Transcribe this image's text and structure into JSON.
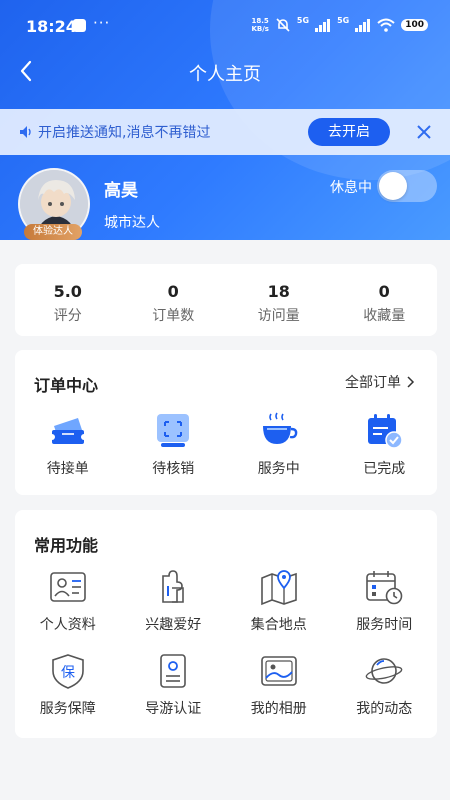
{
  "status_bar": {
    "time": "18:24",
    "dots": "···",
    "speed_value": "18.5",
    "speed_unit": "KB/s",
    "signal_label_1": "5G",
    "signal_label_2": "5G",
    "battery": "100"
  },
  "nav": {
    "title": "个人主页"
  },
  "notify": {
    "text": "开启推送通知,消息不再错过",
    "button": "去开启"
  },
  "profile": {
    "name": "高昊",
    "title": "城市达人",
    "badge": "体验达人",
    "rest_label": "休息中",
    "rest_on": false
  },
  "stats": [
    {
      "value": "5.0",
      "label": "评分"
    },
    {
      "value": "0",
      "label": "订单数"
    },
    {
      "value": "18",
      "label": "访问量"
    },
    {
      "value": "0",
      "label": "收藏量"
    }
  ],
  "orders": {
    "title": "订单中心",
    "all_label": "全部订单",
    "items": [
      {
        "label": "待接单",
        "icon": "ticket-icon"
      },
      {
        "label": "待核销",
        "icon": "scan-icon"
      },
      {
        "label": "服务中",
        "icon": "coffee-cup-icon"
      },
      {
        "label": "已完成",
        "icon": "calendar-check-icon"
      }
    ]
  },
  "functions": {
    "title": "常用功能",
    "items": [
      {
        "label": "个人资料",
        "icon": "id-card-icon"
      },
      {
        "label": "兴趣爱好",
        "icon": "puzzle-icon"
      },
      {
        "label": "集合地点",
        "icon": "map-pin-icon"
      },
      {
        "label": "服务时间",
        "icon": "calendar-clock-icon"
      },
      {
        "label": "服务保障",
        "icon": "shield-icon"
      },
      {
        "label": "导游认证",
        "icon": "badge-card-icon"
      },
      {
        "label": "我的相册",
        "icon": "photo-icon"
      },
      {
        "label": "我的动态",
        "icon": "planet-icon"
      }
    ]
  },
  "colors": {
    "primary": "#1d5ff0",
    "accent_orange": "#d9904f"
  }
}
